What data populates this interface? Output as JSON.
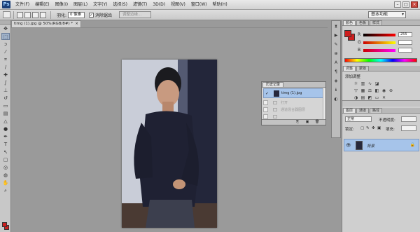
{
  "app": {
    "logo": "Ps"
  },
  "menu": [
    "文件(F)",
    "编辑(E)",
    "图像(I)",
    "图层(L)",
    "文字(Y)",
    "选择(S)",
    "滤镜(T)",
    "3D(D)",
    "视图(V)",
    "窗口(W)",
    "帮助(H)"
  ],
  "options": {
    "feather_label": "羽化:",
    "feather_value": "0 像素",
    "antialias_checked": "✓",
    "antialias_label": "消除锯齿",
    "refine_edge": "调整边缘..."
  },
  "workspace": "基本功能",
  "window_controls": {
    "minimize": "–",
    "maximize": "□",
    "close": "×"
  },
  "document_tab": {
    "title": "timg (1).jpg @ 50%(RGB/8#) *",
    "close": "×"
  },
  "history_panel": {
    "tabs": [
      "历史记录"
    ],
    "snapshot_check": "✓",
    "snapshot_label": "timg (1).jpg",
    "items": [
      "打开",
      "通道混合器图层"
    ]
  },
  "color_panel": {
    "tabs": [
      "颜色",
      "色板",
      "样式"
    ],
    "channels": [
      {
        "letter": "R",
        "value": "255"
      },
      {
        "letter": "G",
        "value": ""
      },
      {
        "letter": "B",
        "value": ""
      }
    ]
  },
  "adjustments_panel": {
    "tabs": [
      "调整",
      "蒙版"
    ],
    "title": "添加调整"
  },
  "layers_panel": {
    "tabs": [
      "图层",
      "通道",
      "路径"
    ],
    "blend_mode": "正常",
    "opacity_label": "不透明度:",
    "lock_label": "锁定:",
    "fill_label": "填充:",
    "layer_name": "背景",
    "eye": "👁",
    "lock_icon": "🔒"
  },
  "colors": {
    "foreground": "#cc1e1e",
    "selected_row": "#a6c4ea"
  }
}
